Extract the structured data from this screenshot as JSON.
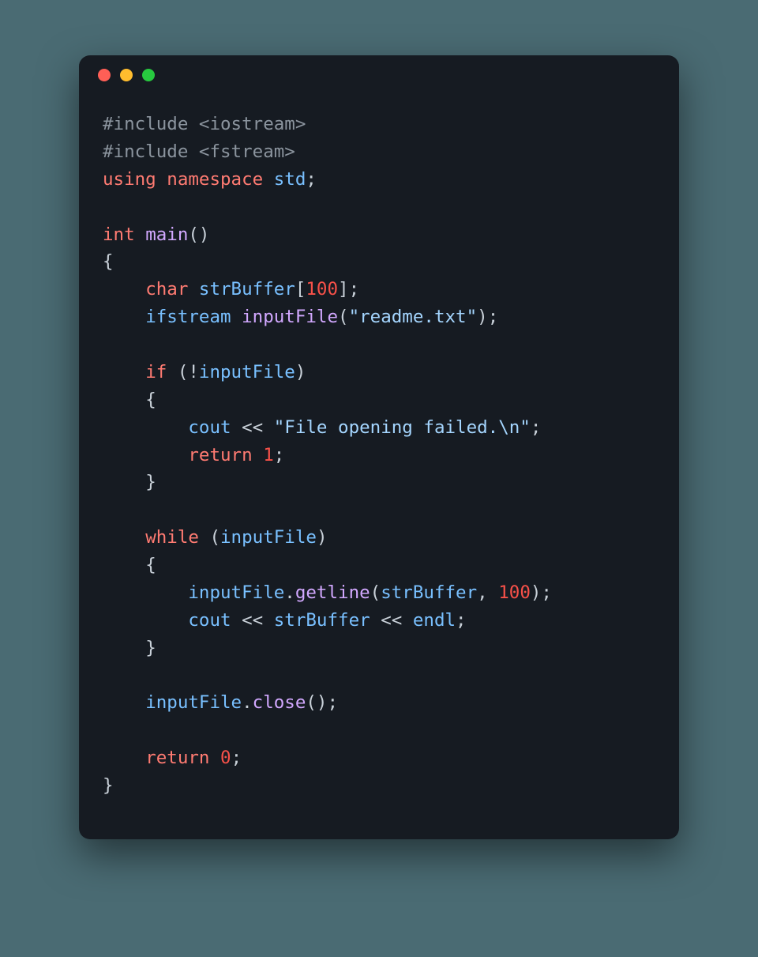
{
  "window": {
    "dots": [
      "red",
      "yellow",
      "green"
    ]
  },
  "colors": {
    "background_page": "#4a6b73",
    "background_window": "#161b22",
    "dot_red": "#ff5f56",
    "dot_yellow": "#ffbd2e",
    "dot_green": "#27c93f",
    "text_default": "#c9d1d9",
    "token_preprocessor": "#8b949e",
    "token_keyword": "#ff7b72",
    "token_function": "#d2a8ff",
    "token_variable": "#79c0ff",
    "token_number": "#f85149",
    "token_string": "#a5d6ff"
  },
  "code": {
    "language": "cpp",
    "tokens": {
      "include1": "#include <iostream>",
      "include2": "#include <fstream>",
      "using": "using",
      "namespace_kw": "namespace",
      "std": "std",
      "semi": ";",
      "int": "int",
      "main": "main",
      "parens": "()",
      "lbrace": "{",
      "rbrace": "}",
      "char": "char",
      "strBuffer": "strBuffer",
      "lbracket": "[",
      "hundred": "100",
      "rbracket": "]",
      "ifstream": "ifstream",
      "inputFile": "inputFile",
      "lparen": "(",
      "readme": "\"readme.txt\"",
      "rparen": ")",
      "if": "if",
      "bang": "!",
      "cout": "cout",
      "lshift": "<<",
      "file_fail": "\"File opening failed.\\n\"",
      "return": "return",
      "one": "1",
      "while": "while",
      "getline": "getline",
      "comma": ",",
      "endl": "endl",
      "dot": ".",
      "close": "close",
      "zero": "0"
    },
    "plain_source": "#include <iostream>\n#include <fstream>\nusing namespace std;\n\nint main()\n{\n    char strBuffer[100];\n    ifstream inputFile(\"readme.txt\");\n\n    if (!inputFile)\n    {\n        cout << \"File opening failed.\\n\";\n        return 1;\n    }\n\n    while (inputFile)\n    {\n        inputFile.getline(strBuffer, 100);\n        cout << strBuffer << endl;\n    }\n\n    inputFile.close();\n\n    return 0;\n}"
  }
}
